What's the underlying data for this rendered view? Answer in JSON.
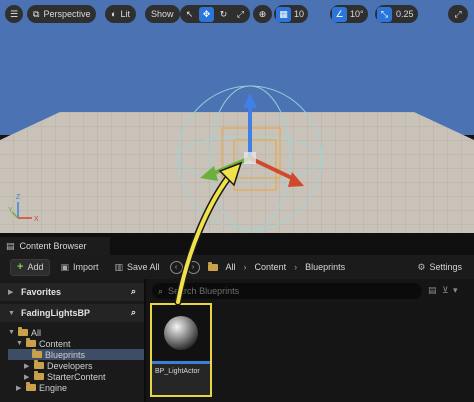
{
  "viewport": {
    "toolbar": {
      "perspective_label": "Perspective",
      "lit_label": "Lit",
      "show_label": "Show",
      "grid_value": "10",
      "rotation_value": "10°",
      "scale_value": "0.25"
    },
    "icons": [
      "menu-icon",
      "select-icon",
      "translate-icon",
      "rotate-icon",
      "scale-icon",
      "world-icon",
      "grid-icon",
      "angle-icon",
      "scale-snap-icon",
      "maximize-icon"
    ]
  },
  "content_browser": {
    "tab_label": "Content Browser",
    "toolbar": {
      "add_label": "Add",
      "import_label": "Import",
      "save_all_label": "Save All",
      "settings_label": "Settings"
    },
    "breadcrumbs": [
      "All",
      "Content",
      "Blueprints"
    ],
    "favorites_label": "Favorites",
    "project_label": "FadingLightsBP",
    "tree": [
      {
        "label": "All",
        "level": 0
      },
      {
        "label": "Content",
        "level": 1
      },
      {
        "label": "Blueprints",
        "level": 2,
        "selected": true
      },
      {
        "label": "Developers",
        "level": 2
      },
      {
        "label": "StarterContent",
        "level": 2
      },
      {
        "label": "Engine",
        "level": 1
      }
    ],
    "search_placeholder": "Search Blueprints",
    "asset_label": "BP_LightActor"
  },
  "colors": {
    "sky": "#4b73b4",
    "accent_blue": "#2b76d8",
    "highlight_yellow": "#f1e24a",
    "folder": "#caa14b",
    "add_green": "#7fcf4a"
  }
}
